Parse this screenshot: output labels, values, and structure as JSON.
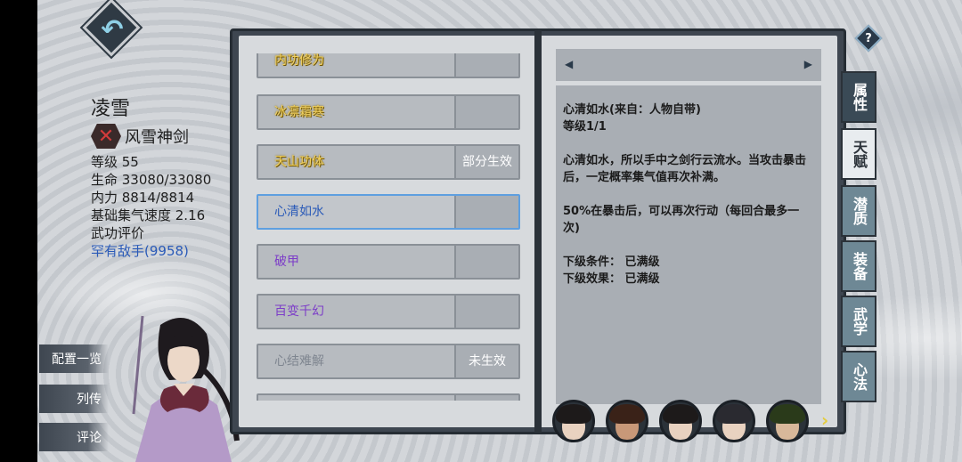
{
  "character": {
    "name": "凌雪",
    "title": "风雪神剑",
    "level": "等级 55",
    "hp": "生命 33080/33080",
    "mp": "内力 8814/8814",
    "speed": "基础集气速度 2.16",
    "rating_label": "武功评价",
    "rating_value": "罕有敌手(9958)"
  },
  "side_menu": {
    "config": "配置一览",
    "biography": "列传",
    "comment": "评论"
  },
  "skills": [
    {
      "name": "内功修为",
      "status": "",
      "color": "gold"
    },
    {
      "name": "冰凛霜寒",
      "status": "",
      "color": "gold"
    },
    {
      "name": "天山功体",
      "status": "部分生效",
      "color": "gold"
    },
    {
      "name": "心清如水",
      "status": "",
      "color": "blue",
      "selected": true
    },
    {
      "name": "破甲",
      "status": "",
      "color": "purple"
    },
    {
      "name": "百变千幻",
      "status": "",
      "color": "purple"
    },
    {
      "name": "心结难解",
      "status": "未生效",
      "color": "grey"
    }
  ],
  "detail": {
    "line1": "心清如水(来自：人物自带)",
    "line2": "等级1/1",
    "line3": "心清如水，所以手中之剑行云流水。当攻击暴击后，一定概率集气值再次补满。",
    "line4": "50%在暴击后，可以再次行动（每回合最多一次)",
    "line5": "下级条件： 已满级",
    "line6": "下级效果： 已满级",
    "prev_icon": "◀",
    "next_icon": "▶"
  },
  "tabs": [
    {
      "label": "属性"
    },
    {
      "label": "天赋"
    },
    {
      "label": "潜质"
    },
    {
      "label": "装备"
    },
    {
      "label": "武学"
    },
    {
      "label": "心法"
    }
  ],
  "help": "?",
  "avatars_next": "›",
  "colors": {
    "gold": "#f0d060",
    "purple": "#7c3cc8",
    "blue": "#2a5ab8",
    "grey": "#7f8690",
    "selected_border": "#5e9fe0"
  }
}
